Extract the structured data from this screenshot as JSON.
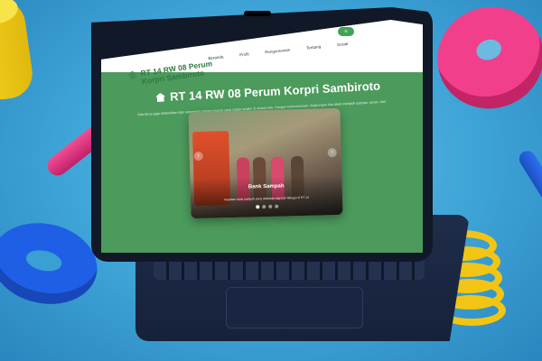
{
  "site": {
    "brand": "RT 14 RW 08 Perum Korpri Sambiroto",
    "brand_icon": "house-icon"
  },
  "nav": {
    "links": [
      "Beranda",
      "Profil",
      "Pengumuman",
      "Tentang",
      "Sosial"
    ],
    "button_icon": "menu-icon"
  },
  "hero": {
    "title": "RT 14 RW 08 Perum Korpri Sambiroto",
    "title_icon": "house-icon",
    "description": "Kita terus juga kebersihan dan semangat gotong royong yang selalu terjalin di antara kita. Dengan kebersamaan, lingkungan kita akan menjadi nyaman, aman, dan penuh kehangatan. Jaga semangat, salam gayut rukun!"
  },
  "carousel": {
    "slide_title": "Bank Sampah",
    "slide_caption": "Kegiatan bank sampah yang diadakan tiap hari Minggu di RT 14",
    "slide_count": 4,
    "active_index": 0,
    "prev_icon": "chevron-left-icon",
    "next_icon": "chevron-right-icon"
  },
  "colors": {
    "accent": "#3fa455",
    "background": "#4c9a5c",
    "navbar": "#ffffff"
  }
}
